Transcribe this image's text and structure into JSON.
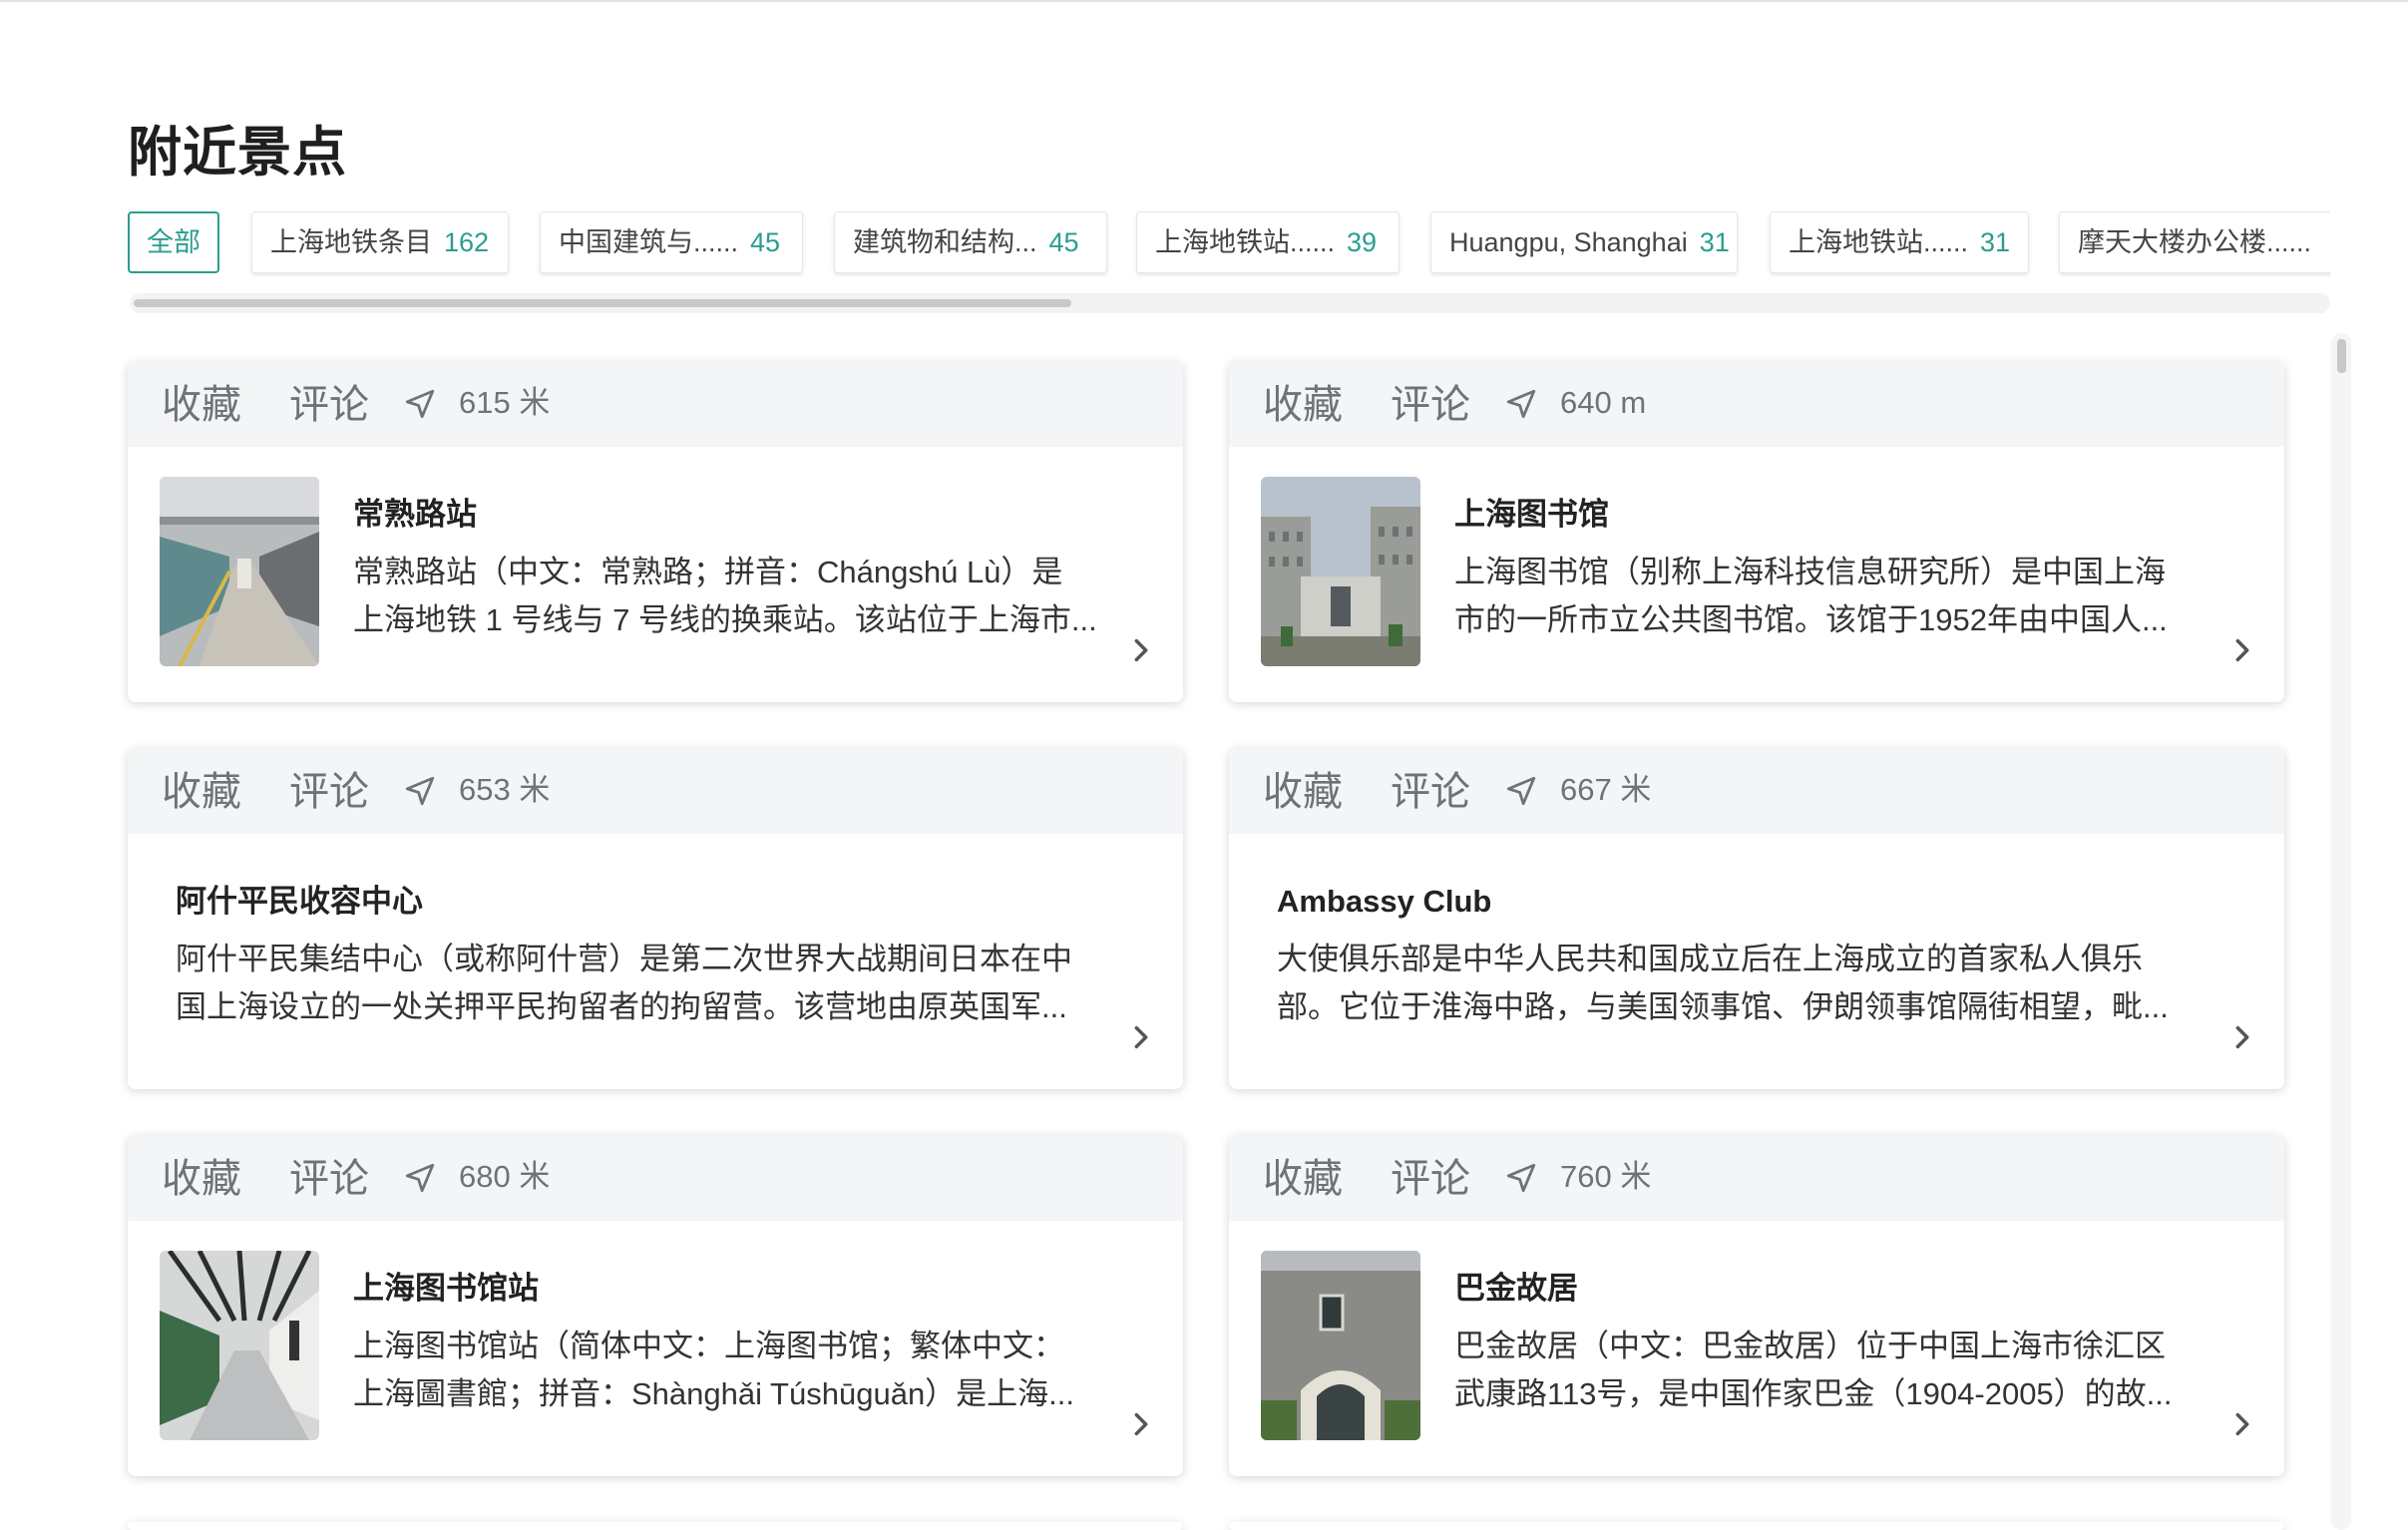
{
  "page": {
    "title": "附近景点"
  },
  "filters": [
    {
      "label": "全部",
      "count": ""
    },
    {
      "label": "上海地铁条目",
      "count": "162"
    },
    {
      "label": "中国建筑与......",
      "count": "45"
    },
    {
      "label": "建筑物和结构...",
      "count": "45"
    },
    {
      "label": "上海地铁站......",
      "count": "39"
    },
    {
      "label": "Huangpu, Shanghai",
      "count": "31"
    },
    {
      "label": "上海地铁站......",
      "count": "31"
    },
    {
      "label": "摩天大楼办公楼......",
      "count": ""
    }
  ],
  "card_actions": {
    "favorite": "收藏",
    "comment": "评论"
  },
  "places": [
    {
      "distance": "615 米",
      "title": "常熟路站",
      "desc_line1": "常熟路站（中文：常熟路；拼音：Chángshú Lù）是",
      "desc_line2": "上海地铁 1 号线与 7 号线的换乘站。该站位于上海市...",
      "thumb": "metro-platform-photo"
    },
    {
      "distance": "640 m",
      "title": "上海图书馆",
      "desc_line1": "上海图书馆（别称上海科技信息研究所）是中国上海",
      "desc_line2": "市的一所市立公共图书馆。该馆于1952年由中国人...",
      "thumb": "library-building-photo"
    },
    {
      "distance": "653 米",
      "title": "阿什平民收容中心",
      "desc_line1": "阿什平民集结中心（或称阿什营）是第二次世界大战期间日本在中",
      "desc_line2": "国上海设立的一处关押平民拘留者的拘留营。该营地由原英国军...",
      "thumb": ""
    },
    {
      "distance": "667 米",
      "title": "Ambassy Club",
      "desc_line1": "大使俱乐部是中华人民共和国成立后在上海成立的首家私人俱乐",
      "desc_line2": "部。它位于淮海中路，与美国领事馆、伊朗领事馆隔街相望，毗...",
      "thumb": ""
    },
    {
      "distance": "680 米",
      "title": "上海图书馆站",
      "desc_line1": "上海图书馆站（简体中文：上海图书馆；繁体中文：",
      "desc_line2": "上海圖書館；拼音：Shànghǎi Túshūguǎn）是上海...",
      "thumb": "metro-station-photo"
    },
    {
      "distance": "760 米",
      "title": "巴金故居",
      "desc_line1": "巴金故居（中文：巴金故居）位于中国上海市徐汇区",
      "desc_line2": "武康路113号，是中国作家巴金（1904-2005）的故...",
      "thumb": "house-facade-photo"
    }
  ],
  "colors": {
    "accent": "#2a9d8f",
    "header_bg": "#f4f5f6",
    "muted": "#6f7378"
  },
  "icons": {
    "distance": "navigation-arrow-icon",
    "open": "chevron-right-icon"
  }
}
